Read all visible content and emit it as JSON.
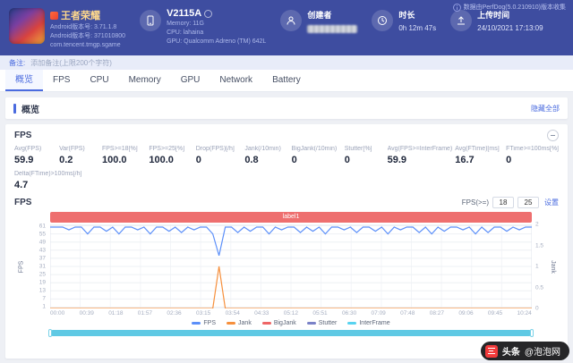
{
  "header": {
    "collect_note": "数据由PerfDog(5.0.210910)版本收集",
    "app": {
      "title": "王者荣耀",
      "version_line1": "Android版本号: 3.71.1.8",
      "version_line2": "Android版本号: 371010800",
      "package": "com.tencent.tmgp.sgame"
    },
    "device": {
      "model": "V2115A",
      "memory": "Memory: 11G",
      "cpu": "CPU: lahaina",
      "gpu": "GPU: Qualcomm Adreno (TM) 642L"
    },
    "creator_label": "创建者",
    "duration_label": "时长",
    "duration_value": "0h 12m 47s",
    "upload_label": "上传时间",
    "upload_value": "24/10/2021 17:13:09"
  },
  "note_bar": {
    "label": "备注:",
    "placeholder": "添加备注(上限200个字符)"
  },
  "tabs": [
    "概览",
    "FPS",
    "CPU",
    "Memory",
    "GPU",
    "Network",
    "Battery"
  ],
  "overview_panel": {
    "title": "概览",
    "action": "隐藏全部"
  },
  "fps_panel": {
    "title": "FPS",
    "stats": [
      {
        "label": "Avg(FPS)",
        "value": "59.9"
      },
      {
        "label": "Var(FPS)",
        "value": "0.2"
      },
      {
        "label": "FPS>=18[%]",
        "value": "100.0"
      },
      {
        "label": "FPS>=25[%]",
        "value": "100.0"
      },
      {
        "label": "Drop(FPS)[/h]",
        "value": "0"
      },
      {
        "label": "Jank(/10min)",
        "value": "0.8"
      },
      {
        "label": "BigJank(/10min)",
        "value": "0"
      },
      {
        "label": "Stutter[%]",
        "value": "0"
      },
      {
        "label": "Avg(FPS>=InterFrame)",
        "value": "59.9"
      },
      {
        "label": "Avg(FTime)[ms]",
        "value": "16.7"
      },
      {
        "label": "FTime>=100ms[%]",
        "value": "0"
      }
    ],
    "stats_row2": [
      {
        "label": "Delta(FTime)>100ms[/h]",
        "value": "4.7"
      }
    ],
    "threshold": {
      "label": "FPS(>=)",
      "low": "18",
      "high": "25",
      "apply": "设置"
    }
  },
  "chart_data": {
    "type": "line",
    "title": "FPS",
    "scene_label": "label1",
    "sample_interval_s": 10,
    "x_ticks": [
      "00:00",
      "00:39",
      "01:18",
      "01:57",
      "02:36",
      "03:15",
      "03:54",
      "04:33",
      "05:12",
      "05:51",
      "06:30",
      "07:09",
      "07:48",
      "08:27",
      "09:06",
      "09:45",
      "10:24"
    ],
    "y_left": {
      "label": "FPS",
      "min": 0,
      "max": 62,
      "ticks": [
        61,
        55,
        49,
        43,
        37,
        31,
        25,
        19,
        13,
        7,
        1
      ]
    },
    "y_right": {
      "label": "Jank",
      "min": 0,
      "max": 2,
      "ticks": [
        2,
        1.5,
        1,
        0.5,
        0
      ]
    },
    "legend_position": "bottom",
    "series": [
      {
        "name": "FPS",
        "axis": "left",
        "color": "#5b8ff9",
        "values": [
          60,
          60,
          60,
          58,
          60,
          60,
          55,
          60,
          60,
          57,
          60,
          55,
          60,
          60,
          58,
          60,
          55,
          60,
          60,
          57,
          60,
          56,
          60,
          58,
          60,
          60,
          55,
          39,
          60,
          60,
          56,
          60,
          57,
          60,
          60,
          55,
          60,
          58,
          60,
          60,
          56,
          60,
          57,
          60,
          55,
          60,
          60,
          58,
          60,
          56,
          60,
          60,
          57,
          60,
          55,
          60,
          58,
          60,
          60,
          56,
          60,
          55,
          60,
          57,
          60,
          60,
          58,
          60,
          55,
          60,
          56,
          60,
          60,
          57,
          60,
          58,
          60,
          60
        ]
      },
      {
        "name": "Jank",
        "axis": "right",
        "color": "#f6903d",
        "values": [
          0,
          0,
          0,
          0,
          0,
          0,
          0,
          0,
          0,
          0,
          0,
          0,
          0,
          0,
          0,
          0,
          0,
          0,
          0,
          0,
          0,
          0,
          0,
          0,
          0,
          0,
          0,
          1,
          0,
          0,
          0,
          0,
          0,
          0,
          0,
          0,
          0,
          0,
          0,
          0,
          0,
          0,
          0,
          0,
          0,
          0,
          0,
          0,
          0,
          0,
          0,
          0,
          0,
          0,
          0,
          0,
          0,
          0,
          0,
          0,
          0,
          0,
          0,
          0,
          0,
          0,
          0,
          0,
          0,
          0,
          0,
          0,
          0,
          0,
          0,
          0,
          0,
          0
        ]
      },
      {
        "name": "BigJank",
        "axis": "right",
        "color": "#ee6666",
        "values": []
      },
      {
        "name": "Stutter",
        "axis": "right",
        "color": "#7a82c8",
        "values": []
      },
      {
        "name": "InterFrame",
        "axis": "left",
        "color": "#58d3f0",
        "values": []
      }
    ]
  },
  "watermark": {
    "brand": "头条",
    "account": "@泡泡网"
  }
}
